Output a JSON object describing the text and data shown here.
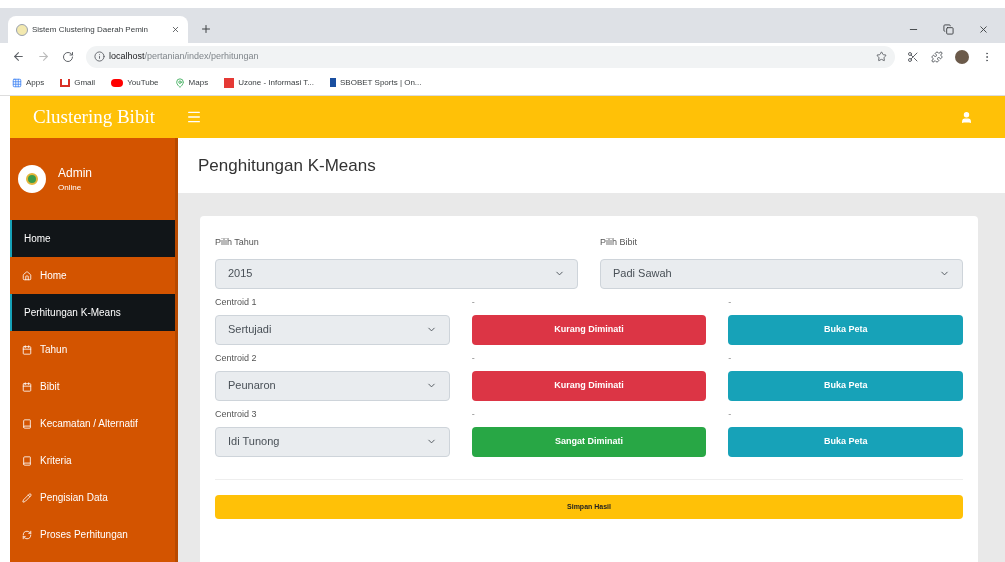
{
  "browser": {
    "tab_title": "Sistem Clustering Daerah Pemin",
    "url_host": "localhost",
    "url_path": "/pertanian/index/perhitungan",
    "bookmarks": [
      "Apps",
      "Gmail",
      "YouTube",
      "Maps",
      "Uzone - Informasi T...",
      "SBOBET Sports | On..."
    ]
  },
  "app": {
    "brand": "Clustering Bibit",
    "user": {
      "name": "Admin",
      "status": "Online"
    }
  },
  "sidebar": {
    "items": [
      {
        "kind": "header",
        "label": "Home"
      },
      {
        "kind": "link",
        "label": "Home"
      },
      {
        "kind": "header",
        "label": "Perhitungan K-Means"
      },
      {
        "kind": "link",
        "label": "Tahun"
      },
      {
        "kind": "link",
        "label": "Bibit"
      },
      {
        "kind": "link",
        "label": "Kecamatan / Alternatif"
      },
      {
        "kind": "link",
        "label": "Kriteria"
      },
      {
        "kind": "link",
        "label": "Pengisian Data"
      },
      {
        "kind": "link",
        "label": "Proses Perhitungan"
      }
    ]
  },
  "page": {
    "title": "Penghitungan K-Means",
    "filters": [
      {
        "label": "Pilih Tahun",
        "value": "2015"
      },
      {
        "label": "Pilih Bibit",
        "value": "Padi Sawah"
      }
    ],
    "centroids": [
      {
        "label": "Centroid 1",
        "value": "Sertujadi",
        "note": "-",
        "result": "Kurang Diminati",
        "kind": "danger",
        "map_note": "-",
        "map_button": "Buka Peta"
      },
      {
        "label": "Centroid 2",
        "value": "Peunaron",
        "note": "-",
        "result": "Kurang Diminati",
        "kind": "danger",
        "map_note": "-",
        "map_button": "Buka Peta"
      },
      {
        "label": "Centroid 3",
        "value": "Idi Tunong",
        "note": "-",
        "result": "Sangat Diminati",
        "kind": "success",
        "map_note": "-",
        "map_button": "Buka Peta"
      }
    ],
    "save_button": "Simpan Hasil"
  }
}
